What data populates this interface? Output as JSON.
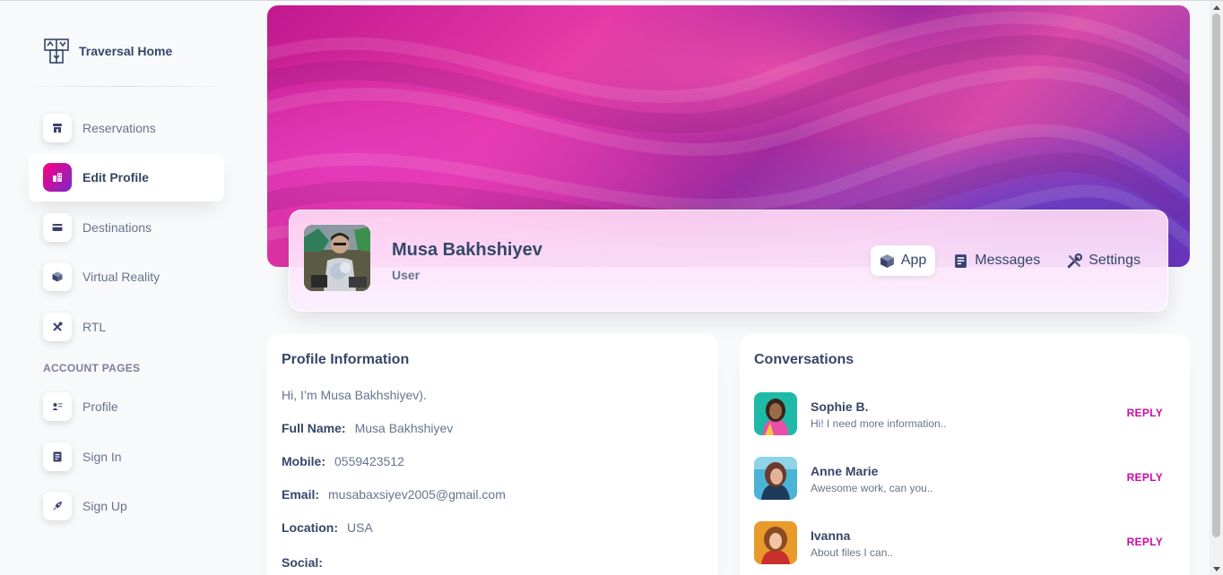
{
  "sidebar": {
    "brand": "Traversal Home",
    "items": [
      {
        "label": "Reservations",
        "icon": "store-icon"
      },
      {
        "label": "Edit Profile",
        "icon": "office-icon",
        "active": true
      },
      {
        "label": "Destinations",
        "icon": "credit-card-icon"
      },
      {
        "label": "Virtual Reality",
        "icon": "box-icon"
      },
      {
        "label": "RTL",
        "icon": "tools-icon"
      }
    ],
    "section_title": "ACCOUNT PAGES",
    "account_items": [
      {
        "label": "Profile",
        "icon": "user-card-icon"
      },
      {
        "label": "Sign In",
        "icon": "document-icon"
      },
      {
        "label": "Sign Up",
        "icon": "rocket-icon"
      }
    ]
  },
  "profile": {
    "name": "Musa Bakhshiyev",
    "role": "User",
    "tabs": [
      {
        "label": "App",
        "icon": "cube-icon",
        "active": true
      },
      {
        "label": "Messages",
        "icon": "document-icon"
      },
      {
        "label": "Settings",
        "icon": "wrench-icon"
      }
    ]
  },
  "info": {
    "title": "Profile Information",
    "intro": "Hi, I’m Musa Bakhshiyev).",
    "rows": [
      {
        "key": "Full Name:",
        "value": "Musa Bakhshiyev"
      },
      {
        "key": "Mobile:",
        "value": "0559423512"
      },
      {
        "key": "Email:",
        "value": "musabaxsiyev2005@gmail.com"
      },
      {
        "key": "Location:",
        "value": "USA"
      },
      {
        "key": "Social:",
        "value": ""
      }
    ]
  },
  "conversations": {
    "title": "Conversations",
    "items": [
      {
        "name": "Sophie B.",
        "message": "Hi! I need more information..",
        "action": "REPLY"
      },
      {
        "name": "Anne Marie",
        "message": "Awesome work, can you..",
        "action": "REPLY"
      },
      {
        "name": "Ivanna",
        "message": "About files I can..",
        "action": "REPLY"
      }
    ]
  },
  "colors": {
    "accent": "#cb0c9f",
    "text_primary": "#344767",
    "text_secondary": "#67748e"
  }
}
